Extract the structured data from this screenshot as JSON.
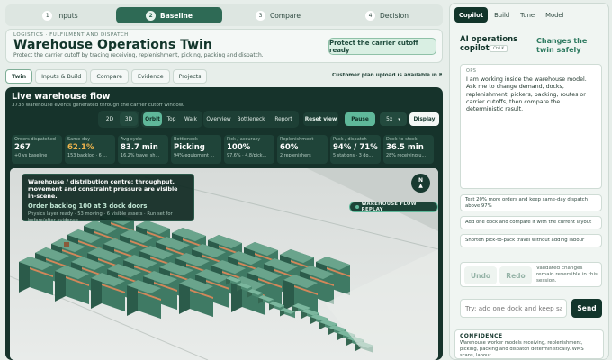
{
  "stepper": [
    {
      "num": "1",
      "label": "Inputs"
    },
    {
      "num": "2",
      "label": "Baseline"
    },
    {
      "num": "3",
      "label": "Compare"
    },
    {
      "num": "4",
      "label": "Decision"
    }
  ],
  "header": {
    "eyebrow": "LOGISTICS · FULFILMENT AND DISPATCH",
    "title": "Warehouse Operations Twin",
    "subtitle": "Protect the carrier cutoff by tracing receiving, replenishment, picking, packing and dispatch.",
    "cta": "Protect the carrier cutoff ready"
  },
  "tabs": [
    "Twin",
    "Inputs & Build",
    "Compare",
    "Evidence",
    "Projects"
  ],
  "upload_note": "Customer plan upload is available in Bu...",
  "flow": {
    "title": "Live warehouse flow",
    "subtitle": "3738 warehouse events generated through the carrier cutoff window.",
    "dims": [
      "2D",
      "3D"
    ],
    "cams": [
      "Orbit",
      "Top",
      "Walk"
    ],
    "views": [
      "Overview",
      "Bottleneck",
      "Report"
    ],
    "reset": "Reset view",
    "pause": "Pause",
    "speed": "5x",
    "display": "Display"
  },
  "metrics": [
    {
      "label": "Orders dispatched",
      "value": "267",
      "sub": "+0 vs baseline",
      "color": "#ffffff"
    },
    {
      "label": "Same-day",
      "value": "62.1%",
      "sub": "153 backlog · 6 ...",
      "color": "#f0b54d"
    },
    {
      "label": "Avg cycle",
      "value": "83.7 min",
      "sub": "16.2% travel sh...",
      "color": "#ffffff"
    },
    {
      "label": "Bottleneck",
      "value": "Picking",
      "sub": "94% equipment ...",
      "color": "#ffffff"
    },
    {
      "label": "Pick / accuracy",
      "value": "100%",
      "sub": "97.6% · 4.8/pick...",
      "color": "#ffffff"
    },
    {
      "label": "Replenishment",
      "value": "60%",
      "sub": "2 replenishers",
      "color": "#ffffff"
    },
    {
      "label": "Pack / dispatch",
      "value": "94% / 71%",
      "sub": "5 stations · 3 do...",
      "color": "#ffffff"
    },
    {
      "label": "Dock-to-stock",
      "value": "36.5 min",
      "sub": "28% receiving u...",
      "color": "#ffffff"
    }
  ],
  "scene": {
    "overlay_title": "Warehouse / distribution centre: throughput, movement and constraint pressure are visible in-scene.",
    "overlay_stat": "Order backlog 100 at 3 dock doors",
    "overlay_detail": "Physics layer ready · 53 moving · 6 visible assets · Run set for before/after evidence",
    "compass": "N",
    "replay": "WAREHOUSE FLOW REPLAY"
  },
  "rail": {
    "tabs": [
      "Copilot",
      "Build",
      "Tune",
      "Model"
    ],
    "title": "AI operations copilot",
    "shortcut": "Ctrl K",
    "tagline": "Changes the twin safely",
    "chat_role": "OPS",
    "chat_msg": "I am working inside the warehouse model. Ask me to change demand, docks, replenishment, pickers, packing, routes or carrier cutoffs, then compare the deterministic result.",
    "suggestions": [
      "Test 20% more orders and keep same-day dispatch above 97%",
      "Add one dock and compare it with the current layout",
      "Shorten pick-to-pack travel without adding labour"
    ],
    "undo": "Undo",
    "redo": "Redo",
    "undo_note": "Validated changes remain reversible in this session.",
    "input_placeholder": "Try: add one dock and keep same-day",
    "send": "Send",
    "confidence_title": "CONFIDENCE",
    "confidence_body": "Warehouse worker models receiving, replenishment, picking, packing and dispatch deterministically. WMS scans, labour..."
  },
  "colors": {
    "accent": "#2e6a55",
    "dark": "#16332b",
    "highlight": "#5fb89a",
    "warning": "#f0b54d"
  }
}
